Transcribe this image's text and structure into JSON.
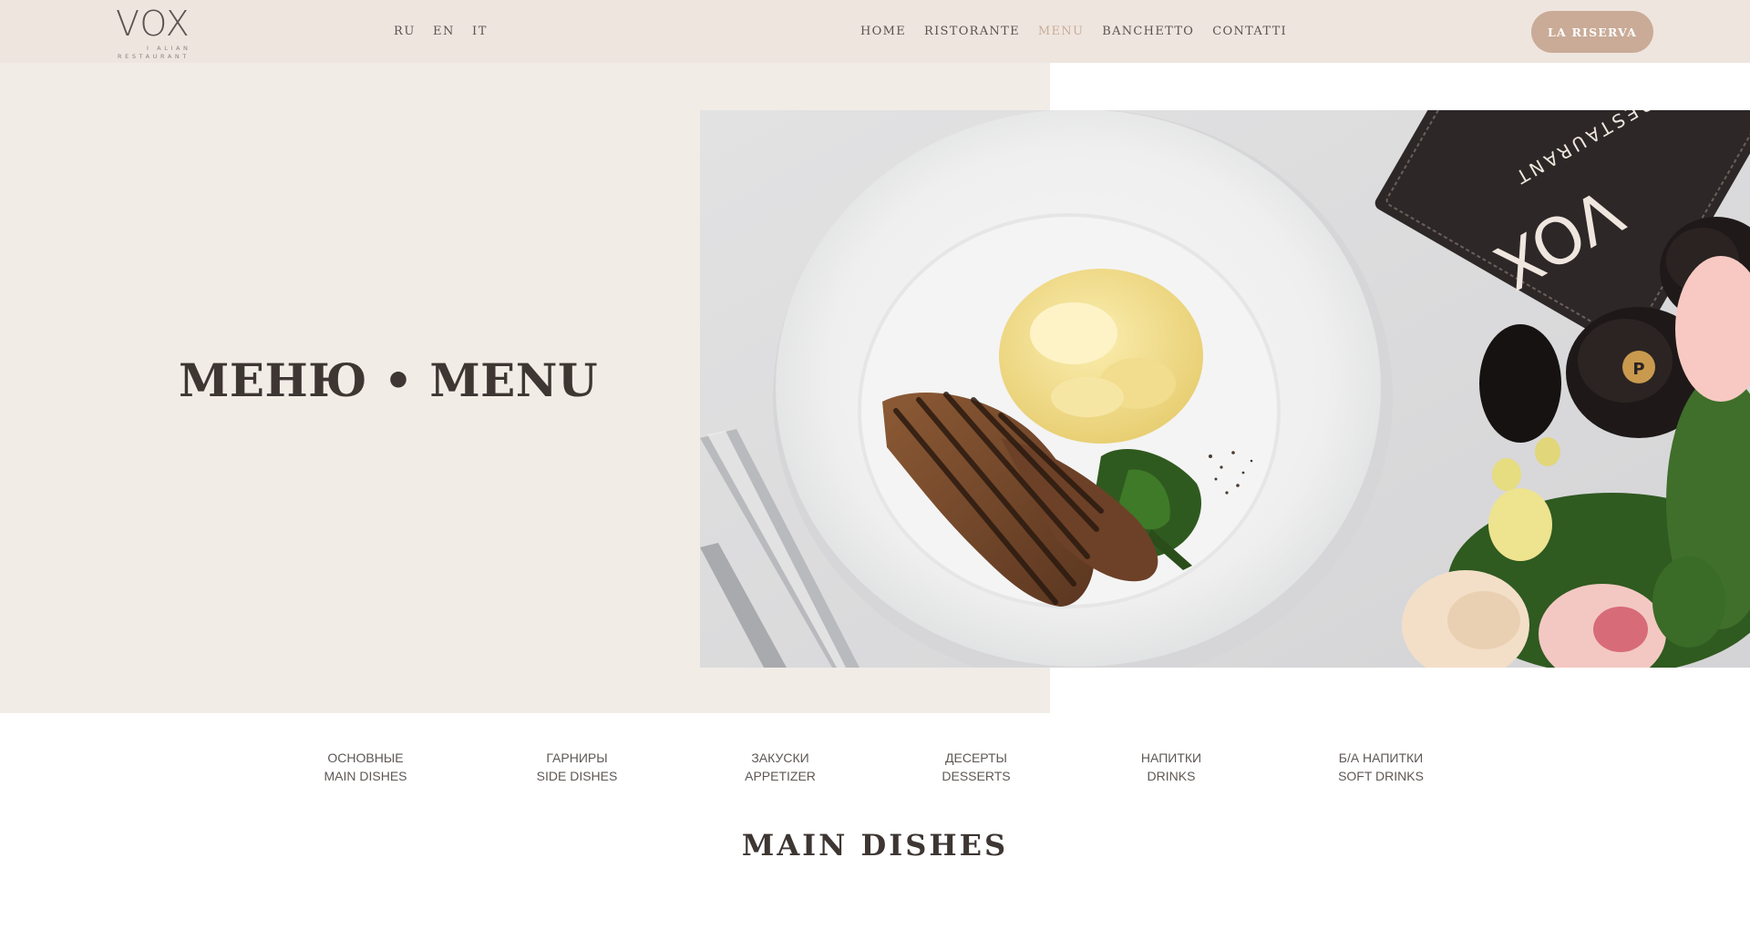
{
  "header": {
    "logo": {
      "main": "VOX",
      "sub1": "I ALIAN",
      "sub2": "RESTAURANT"
    },
    "languages": [
      "RU",
      "EN",
      "IT"
    ],
    "nav": [
      {
        "label": "HOME",
        "active": false
      },
      {
        "label": "RISTORANTE",
        "active": false
      },
      {
        "label": "MENU",
        "active": true
      },
      {
        "label": "BANCHETTO",
        "active": false
      },
      {
        "label": "CONTATTI",
        "active": false
      }
    ],
    "reserve_label": "LA RISERVA"
  },
  "hero": {
    "title": "МЕНЮ • MENU",
    "menu_book_text": "VOX",
    "menu_book_sub": "RESTAURANT"
  },
  "categories": [
    {
      "ru": "ОСНОВНЫЕ",
      "en": "MAIN DISHES"
    },
    {
      "ru": "ГАРНИРЫ",
      "en": "SIDE DISHES"
    },
    {
      "ru": "ЗАКУСКИ",
      "en": "APPETIZER"
    },
    {
      "ru": "ДЕСЕРТЫ",
      "en": "DESSERTS"
    },
    {
      "ru": "НАПИТКИ",
      "en": "DRINKS"
    },
    {
      "ru": "Б/А НАПИТКИ",
      "en": "SOFT DRINKS"
    }
  ],
  "section_title": "MAIN DISHES",
  "colors": {
    "header_bg": "#efe5df",
    "hero_bg": "#f2ece7",
    "accent": "#c9ab97",
    "active_nav": "#c8ad98"
  }
}
